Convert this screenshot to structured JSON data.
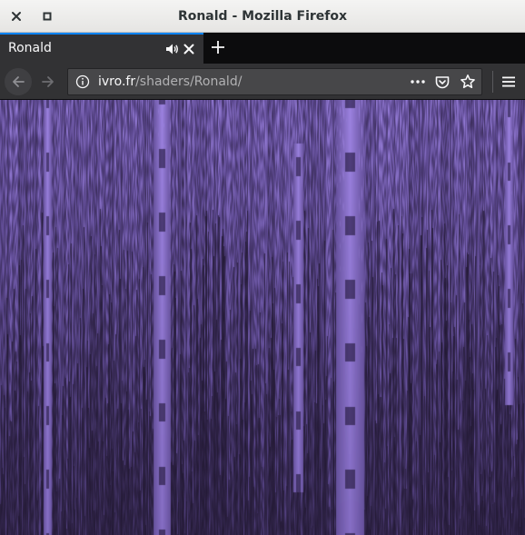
{
  "window": {
    "title": "Ronald - Mozilla Firefox",
    "close_icon": "close-icon",
    "maximize_icon": "maximize-icon"
  },
  "tabs": [
    {
      "label": "Ronald",
      "active": true,
      "audio_icon": "speaker-icon",
      "close_icon": "close-icon"
    }
  ],
  "new_tab_icon": "plus-icon",
  "navbar": {
    "back_icon": "arrow-left-icon",
    "forward_icon": "arrow-right-icon",
    "url": {
      "domain": "ivro.fr",
      "path": "/shaders/Ronald/",
      "info_icon": "info-icon"
    },
    "page_actions_icon": "ellipsis-icon",
    "pocket_icon": "pocket-icon",
    "bookmark_icon": "star-icon",
    "menu_icon": "hamburger-menu-icon"
  },
  "content": {
    "type": "shader-canvas",
    "colors": {
      "background": "#120c1c",
      "stripe_light": "#9c82e0",
      "stripe_mid": "#5e4a92",
      "stripe_dark": "#1a1226",
      "accent": "#0a84ff"
    }
  }
}
